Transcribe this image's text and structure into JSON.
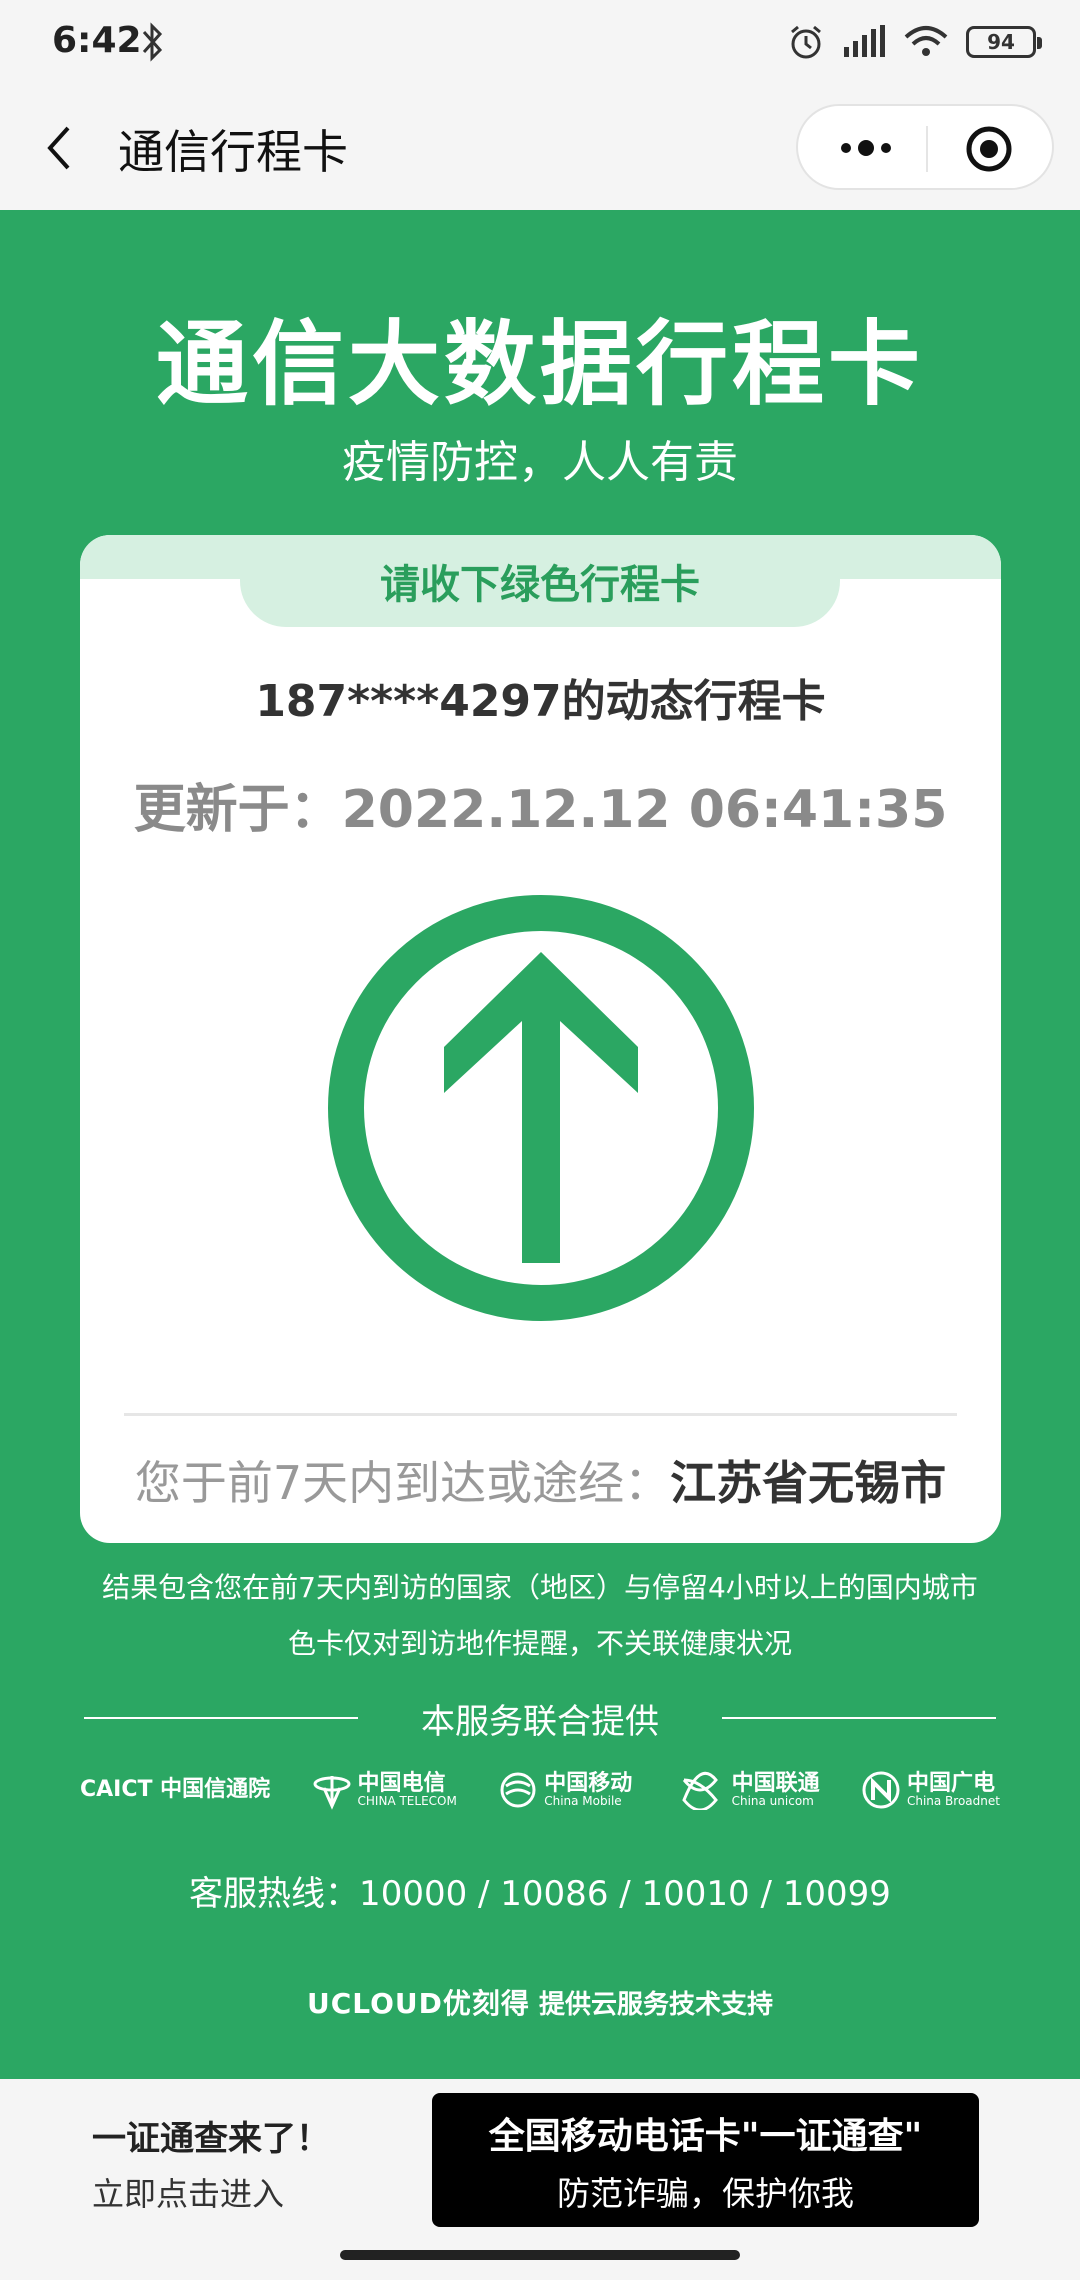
{
  "status_bar": {
    "time": "6:42",
    "battery": "94",
    "icons": [
      "bluetooth-icon",
      "alarm-icon",
      "signal-icon",
      "wifi-icon",
      "battery-icon"
    ]
  },
  "nav": {
    "title": "通信行程卡",
    "icons": [
      "back-icon",
      "more-icon",
      "target-icon"
    ]
  },
  "header": {
    "title": "通信大数据行程卡",
    "subtitle": "疫情防控，人人有责"
  },
  "card": {
    "tab_label": "请收下绿色行程卡",
    "phone_line": "187****4297的动态行程卡",
    "updated_line": "更新于：2022.12.12 06:41:35",
    "arrow_color": "#2ba763",
    "visited_prefix": "您于前7天内到达或途经：",
    "visited_city": "江苏省无锡市"
  },
  "notes": {
    "line1": "结果包含您在前7天内到访的国家（地区）与停留4小时以上的国内城市",
    "line2": "色卡仅对到访地作提醒，不关联健康状况"
  },
  "service": {
    "label": "本服务联合提供",
    "logos": [
      {
        "cn": "CAICT 中国信通院",
        "en": ""
      },
      {
        "cn": "中国电信",
        "en": "CHINA TELECOM"
      },
      {
        "cn": "中国移动",
        "en": "China Mobile"
      },
      {
        "cn": "中国联通",
        "en": "China unicom"
      },
      {
        "cn": "中国广电",
        "en": "China Broadnet"
      }
    ]
  },
  "hotline": "客服热线：10000  /  10086  /  10010  /  10099",
  "ucloud": {
    "brand": "UCLOUD优刻得",
    "text": "提供云服务技术支持"
  },
  "banner": {
    "left_title": "一证通查来了！",
    "left_subtitle": "立即点击进入",
    "button_line1": "全国移动电话卡\"一证通查\"",
    "button_line2": "防范诈骗，保护你我"
  },
  "colors": {
    "brand_green": "#2ba763",
    "tab_green_bg": "#d6f0e1",
    "tab_green_text": "#2a9e5c"
  }
}
